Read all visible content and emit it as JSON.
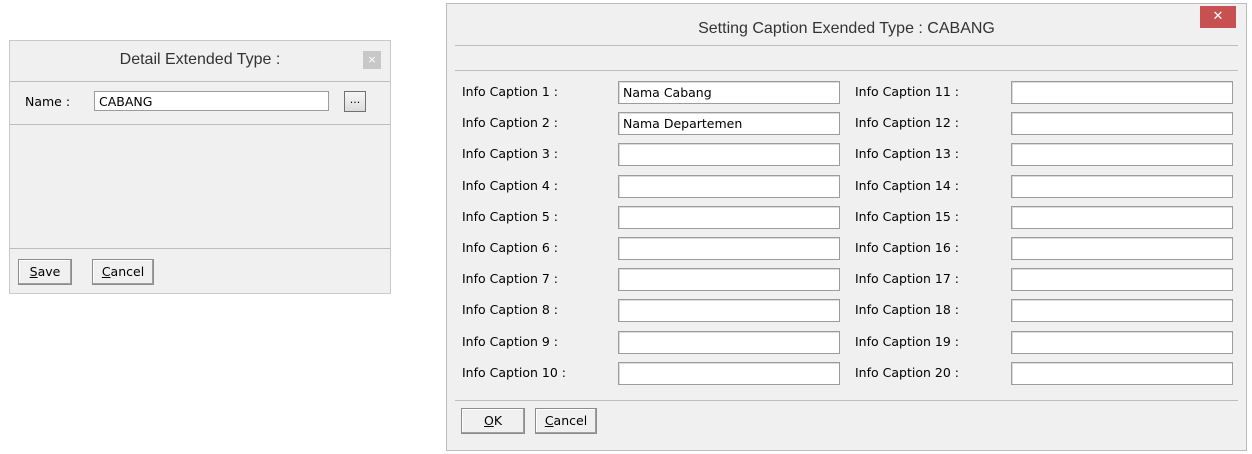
{
  "detail_dialog": {
    "title": "Detail Extended Type :",
    "close_glyph": "×",
    "name_label": "Name :",
    "name_value": "CABANG",
    "browse_label": "...",
    "save_prefix": "S",
    "save_rest": "ave",
    "cancel_prefix": "C",
    "cancel_rest": "ancel"
  },
  "caption_dialog": {
    "title": "Setting Caption Exended Type : CABANG",
    "close_glyph": "✕",
    "ok_prefix": "O",
    "ok_rest": "K",
    "cancel_prefix": "C",
    "cancel_rest": "ancel",
    "left_captions": [
      {
        "label": "Info Caption 1 :",
        "value": "Nama Cabang"
      },
      {
        "label": "Info Caption 2 :",
        "value": "Nama Departemen"
      },
      {
        "label": "Info Caption 3 :",
        "value": ""
      },
      {
        "label": "Info Caption 4 :",
        "value": ""
      },
      {
        "label": "Info Caption 5 :",
        "value": ""
      },
      {
        "label": "Info Caption 6 :",
        "value": ""
      },
      {
        "label": "Info Caption 7 :",
        "value": ""
      },
      {
        "label": "Info Caption 8 :",
        "value": ""
      },
      {
        "label": "Info Caption 9 :",
        "value": ""
      },
      {
        "label": "Info Caption 10 :",
        "value": ""
      }
    ],
    "right_captions": [
      {
        "label": "Info Caption 11 :",
        "value": ""
      },
      {
        "label": "Info Caption 12 :",
        "value": ""
      },
      {
        "label": "Info Caption 13 :",
        "value": ""
      },
      {
        "label": "Info Caption 14 :",
        "value": ""
      },
      {
        "label": "Info Caption 15 :",
        "value": ""
      },
      {
        "label": "Info Caption 16 :",
        "value": ""
      },
      {
        "label": "Info Caption 17 :",
        "value": ""
      },
      {
        "label": "Info Caption 18 :",
        "value": ""
      },
      {
        "label": "Info Caption 19 :",
        "value": ""
      },
      {
        "label": "Info Caption 20 :",
        "value": ""
      }
    ]
  }
}
